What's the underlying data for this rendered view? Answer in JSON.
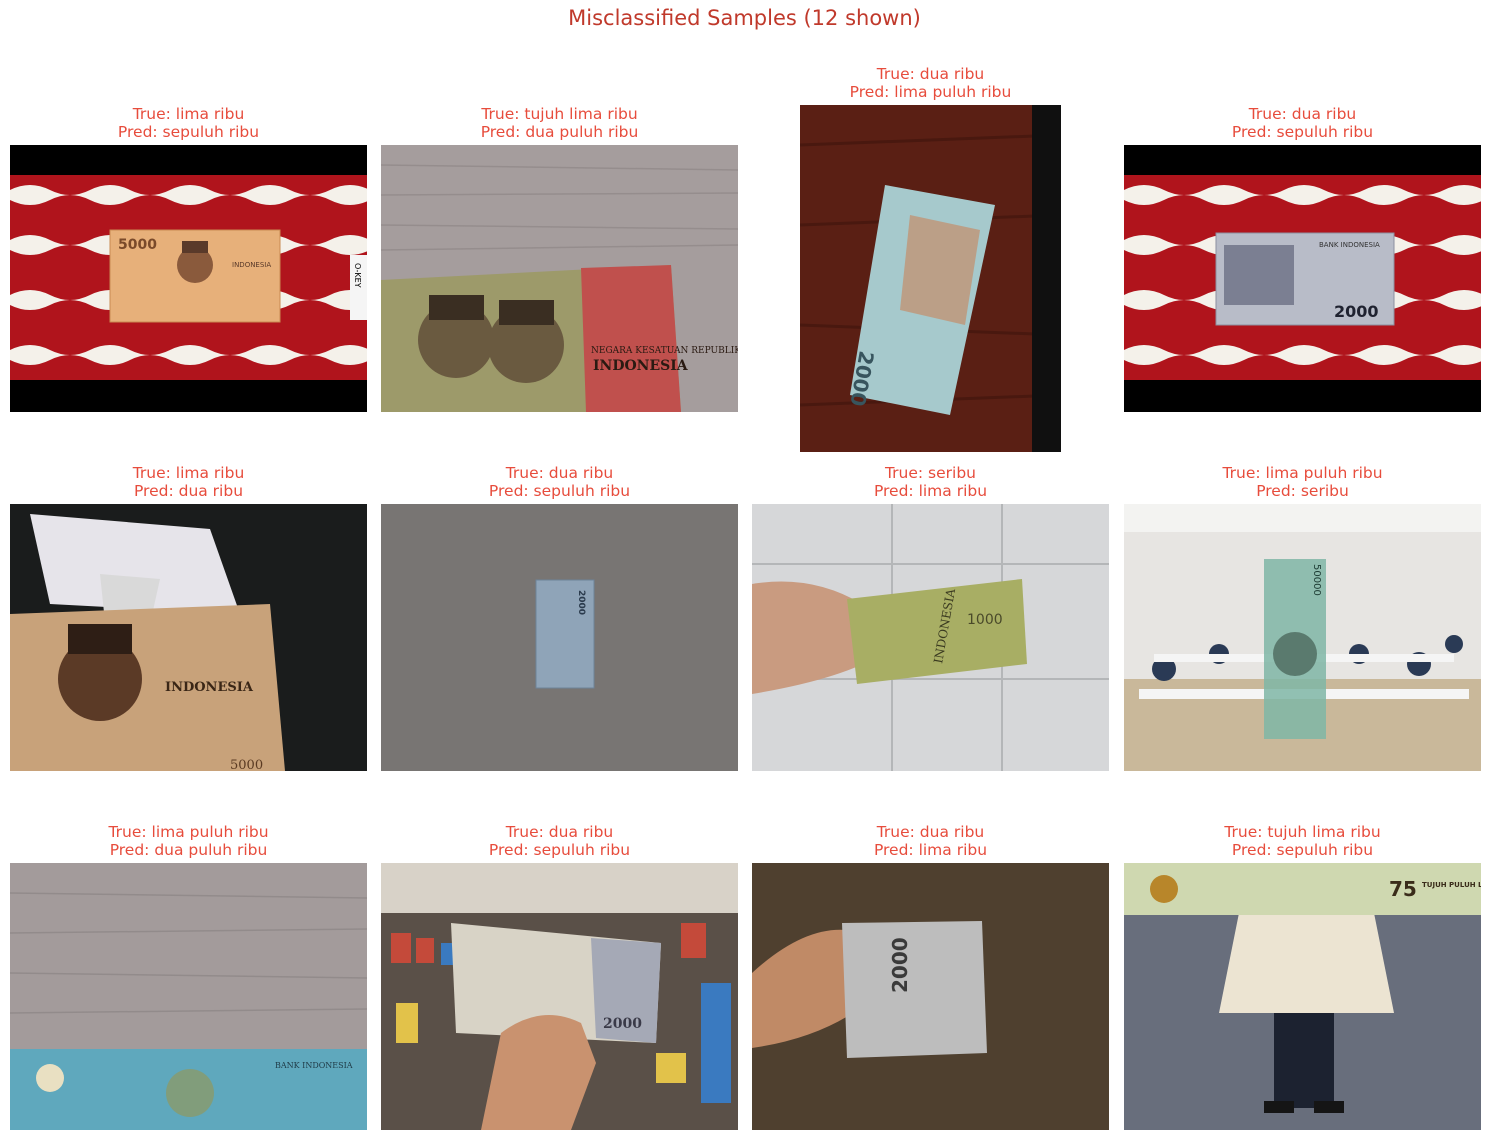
{
  "figure": {
    "title": "Misclassified Samples (12 shown)",
    "title_color": "#c0392b",
    "label_color": "#e74c3c"
  },
  "samples": [
    {
      "true_label": "True: lima ribu",
      "pred_label": "Pred: sepuluh ribu",
      "image": "5000-note-on-red-batik-cloth",
      "note_text": "5000",
      "logo_text": "INDONESIA",
      "side_text": "O-KEY"
    },
    {
      "true_label": "True: tujuh lima ribu",
      "pred_label": "Pred: dua puluh ribu",
      "image": "75000-note-closeup-on-wood",
      "note_text": "NEGARA KESATUAN REPUBLIK",
      "logo_text": "INDONESIA"
    },
    {
      "true_label": "True: dua ribu",
      "pred_label": "Pred: lima puluh ribu",
      "image": "2000-note-on-dark-wood",
      "note_text": "2000"
    },
    {
      "true_label": "True: dua ribu",
      "pred_label": "Pred: sepuluh ribu",
      "image": "2000-note-on-red-batik-cloth",
      "note_text": "2000",
      "logo_text": "BANK INDONESIA"
    },
    {
      "true_label": "True: lima ribu",
      "pred_label": "Pred: dua ribu",
      "image": "5000-note-in-bag",
      "note_text": "5000",
      "logo_text": "INDONESIA"
    },
    {
      "true_label": "True: dua ribu",
      "pred_label": "Pred: sepuluh ribu",
      "image": "2000-note-on-grey-carpet",
      "note_text": "2000"
    },
    {
      "true_label": "True: seribu",
      "pred_label": "Pred: lima ribu",
      "image": "1000-note-held-against-tiles",
      "note_text": "1000",
      "logo_text": "INDONESIA"
    },
    {
      "true_label": "True: lima puluh ribu",
      "pred_label": "Pred: seribu",
      "image": "50000-note-overlay-on-classroom",
      "note_text": "50000"
    },
    {
      "true_label": "True: lima puluh ribu",
      "pred_label": "Pred: dua puluh ribu",
      "image": "50000-note-edge-on-wood",
      "note_text": "BANK INDONESIA"
    },
    {
      "true_label": "True: dua ribu",
      "pred_label": "Pred: sepuluh ribu",
      "image": "2000-note-held-in-store",
      "note_text": "2000"
    },
    {
      "true_label": "True: dua ribu",
      "pred_label": "Pred: lima ribu",
      "image": "2000-note-folded-in-hand",
      "note_text": "2000"
    },
    {
      "true_label": "True: tujuh lima ribu",
      "pred_label": "Pred: sepuluh ribu",
      "image": "75000-note-overlay-on-person",
      "note_text": "TUJUH PULUH LIMA RIBU RUPIAH",
      "value_text": "75"
    }
  ]
}
